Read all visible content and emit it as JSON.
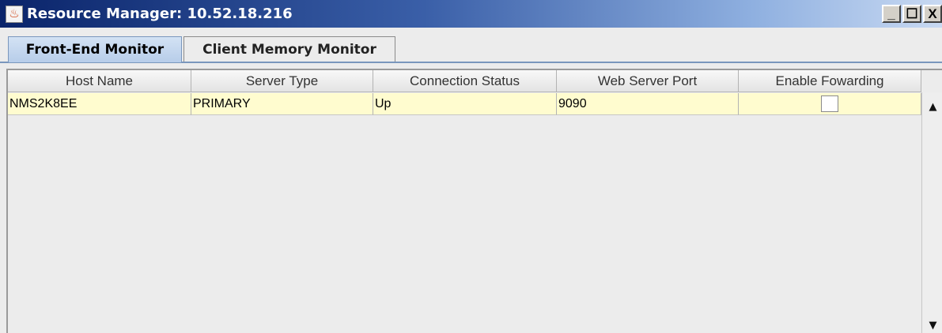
{
  "window": {
    "title": "Resource Manager: 10.52.18.216",
    "app_icon": "java-cup-icon",
    "minimize": "_",
    "maximize": "☐",
    "close": "X"
  },
  "tabs": [
    {
      "label": "Front-End Monitor",
      "active": true
    },
    {
      "label": "Client Memory Monitor",
      "active": false
    }
  ],
  "table": {
    "columns": [
      "Host Name",
      "Server Type",
      "Connection Status",
      "Web Server Port",
      "Enable Fowarding"
    ],
    "rows": [
      {
        "host_name": "NMS2K8EE",
        "server_type": "PRIMARY",
        "connection_status": "Up",
        "web_server_port": "9090",
        "enable_forwarding": false
      }
    ],
    "row_highlight_color": "#fffccf"
  },
  "scrollbar": {
    "up_icon": "▲",
    "down_icon": "▼"
  }
}
